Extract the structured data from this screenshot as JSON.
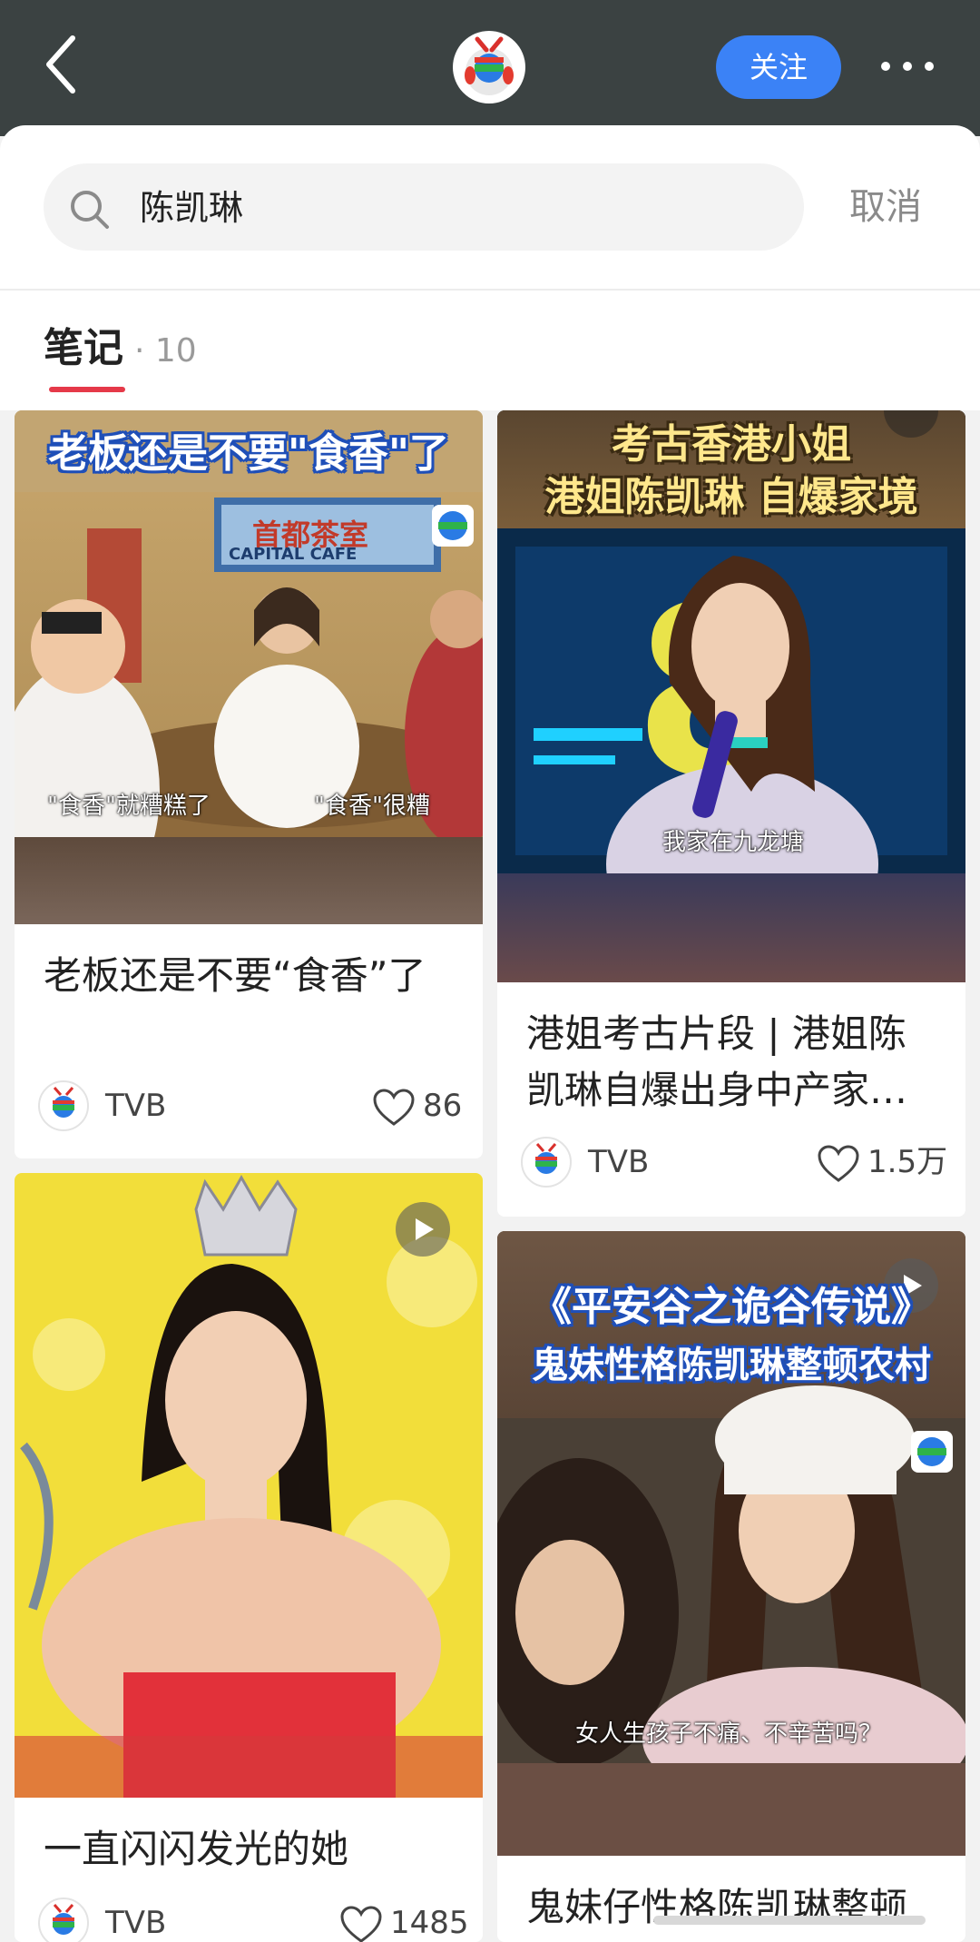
{
  "header": {
    "follow_label": "关注",
    "accent_color": "#3b82f6",
    "icons": [
      "back-chevron-icon",
      "tvb-logo-icon",
      "more-dots-icon"
    ]
  },
  "search": {
    "query": "陈凯琳",
    "cancel_label": "取消"
  },
  "tabs": {
    "active_label": "笔记",
    "active_count": "· 10",
    "underline_color": "#e53949"
  },
  "cards": [
    {
      "title": "老板还是不要“食香”了",
      "image_heading": "老板还是不要\"食香\"了",
      "image_sign": "首都茶室",
      "image_sign_en": "CAPITAL CAFE",
      "image_subtitle_left": "\"食香\"就糟糕了",
      "image_subtitle_right": "\"食香\"很糟",
      "author": "TVB",
      "likes": "86"
    },
    {
      "title": "港姐考古片段 | 港姐陈凯琳自爆出身中产家…",
      "image_heading_line1": "考古香港小姐",
      "image_heading_line2": "港姐陈凯琳 自爆家境",
      "image_subtitle": "我家在九龙塘",
      "author": "TVB",
      "likes": "1.5万"
    },
    {
      "title": "一直闪闪发光的她",
      "author": "TVB",
      "likes": "1485",
      "is_video": true
    },
    {
      "title": "鬼妹仔性格陈凯琳整顿",
      "image_heading_line1": "《平安谷之诡谷传说》",
      "image_heading_line2": "鬼妹性格陈凯琳整顿农村",
      "image_subtitle": "女人生孩子不痛、不辛苦吗？",
      "is_video": true
    }
  ]
}
